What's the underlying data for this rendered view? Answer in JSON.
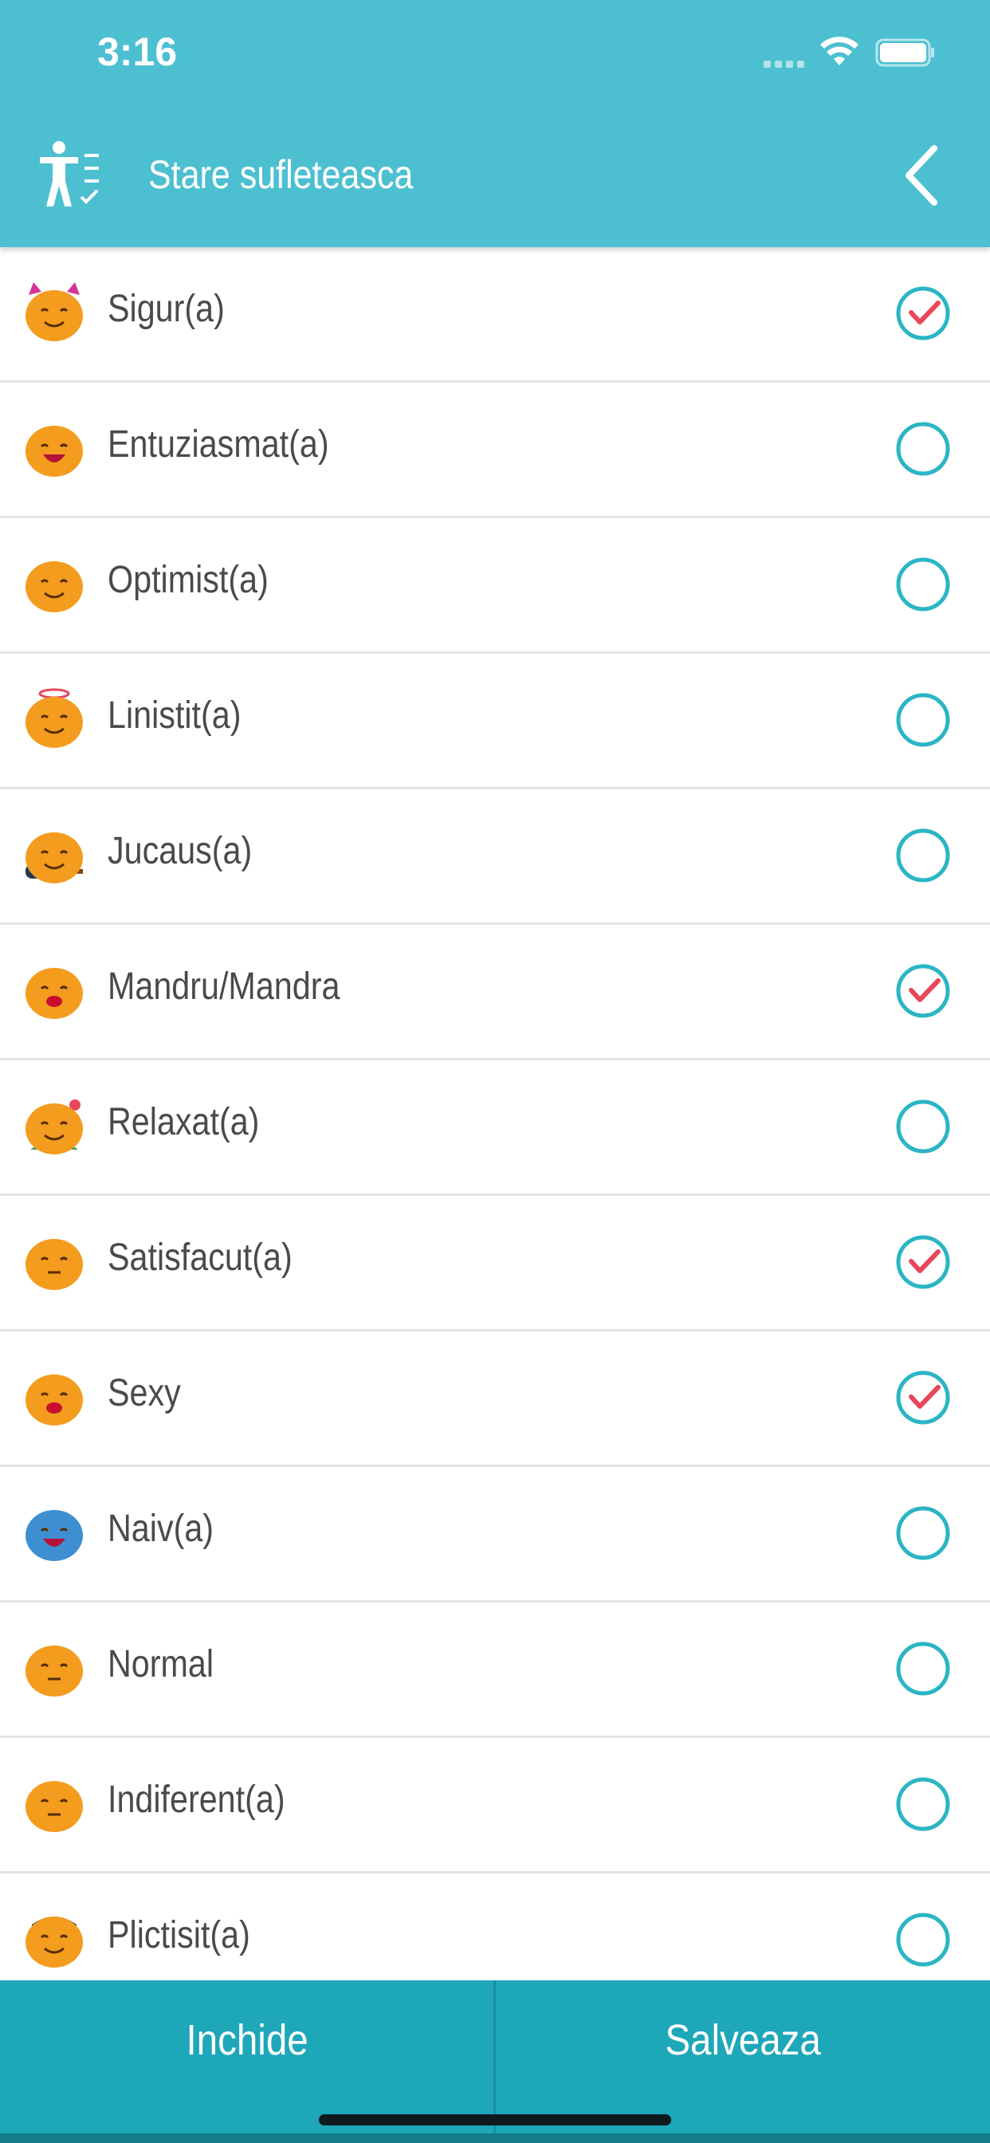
{
  "status_bar": {
    "time": "3:16"
  },
  "header": {
    "title": "Stare sufleteasca",
    "app_icon": "person-checklist-icon",
    "back_icon": "chevron-left-icon"
  },
  "colors": {
    "header_bg": "#4cc0d1",
    "footer_bg": "#1da7b9",
    "check_ring": "#2bb5c5",
    "check_mark": "#e8475a",
    "emoji_orange": "#f39c1e"
  },
  "moods": [
    {
      "label": "Sigur(a)",
      "checked": true,
      "emoji": "devil-face-icon"
    },
    {
      "label": "Entuziasmat(a)",
      "checked": false,
      "emoji": "excited-face-icon"
    },
    {
      "label": "Optimist(a)",
      "checked": false,
      "emoji": "thumbs-up-face-icon"
    },
    {
      "label": "Linistit(a)",
      "checked": false,
      "emoji": "angel-face-icon"
    },
    {
      "label": "Jucaus(a)",
      "checked": false,
      "emoji": "guitar-face-icon"
    },
    {
      "label": "Mandru/Mandra",
      "checked": true,
      "emoji": "proud-face-icon"
    },
    {
      "label": "Relaxat(a)",
      "checked": false,
      "emoji": "relaxed-face-icon"
    },
    {
      "label": "Satisfacut(a)",
      "checked": true,
      "emoji": "satisfied-face-icon"
    },
    {
      "label": "Sexy",
      "checked": true,
      "emoji": "kiss-face-icon"
    },
    {
      "label": "Naiv(a)",
      "checked": false,
      "emoji": "clown-face-icon"
    },
    {
      "label": "Normal",
      "checked": false,
      "emoji": "neutral-face-icon"
    },
    {
      "label": "Indiferent(a)",
      "checked": false,
      "emoji": "indifferent-face-icon"
    },
    {
      "label": "Plictisit(a)",
      "checked": false,
      "emoji": "bored-face-icon"
    }
  ],
  "footer": {
    "close_label": "Inchide",
    "save_label": "Salveaza"
  }
}
